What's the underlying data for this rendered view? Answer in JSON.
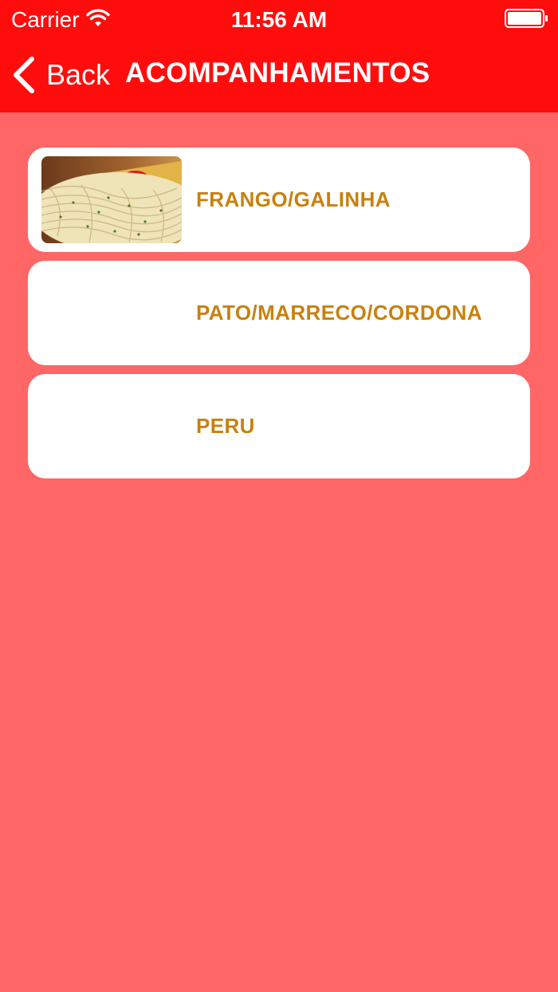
{
  "status_bar": {
    "carrier": "Carrier",
    "time": "11:56 AM",
    "wifi_icon": "wifi-icon",
    "battery_icon": "battery-icon"
  },
  "nav": {
    "back_label": "Back",
    "back_icon": "chevron-left-icon",
    "title": "ACOMPANHAMENTOS"
  },
  "items": [
    {
      "label": "FRANGO/GALINHA",
      "thumbnail": "pasta-photo"
    },
    {
      "label": "PATO/MARRECO/CORDONA"
    },
    {
      "label": "PERU"
    }
  ],
  "colors": {
    "nav_background": "#ff0d0d",
    "page_background": "#ff6666",
    "card_background": "#ffffff",
    "item_text": "#c8810f"
  }
}
